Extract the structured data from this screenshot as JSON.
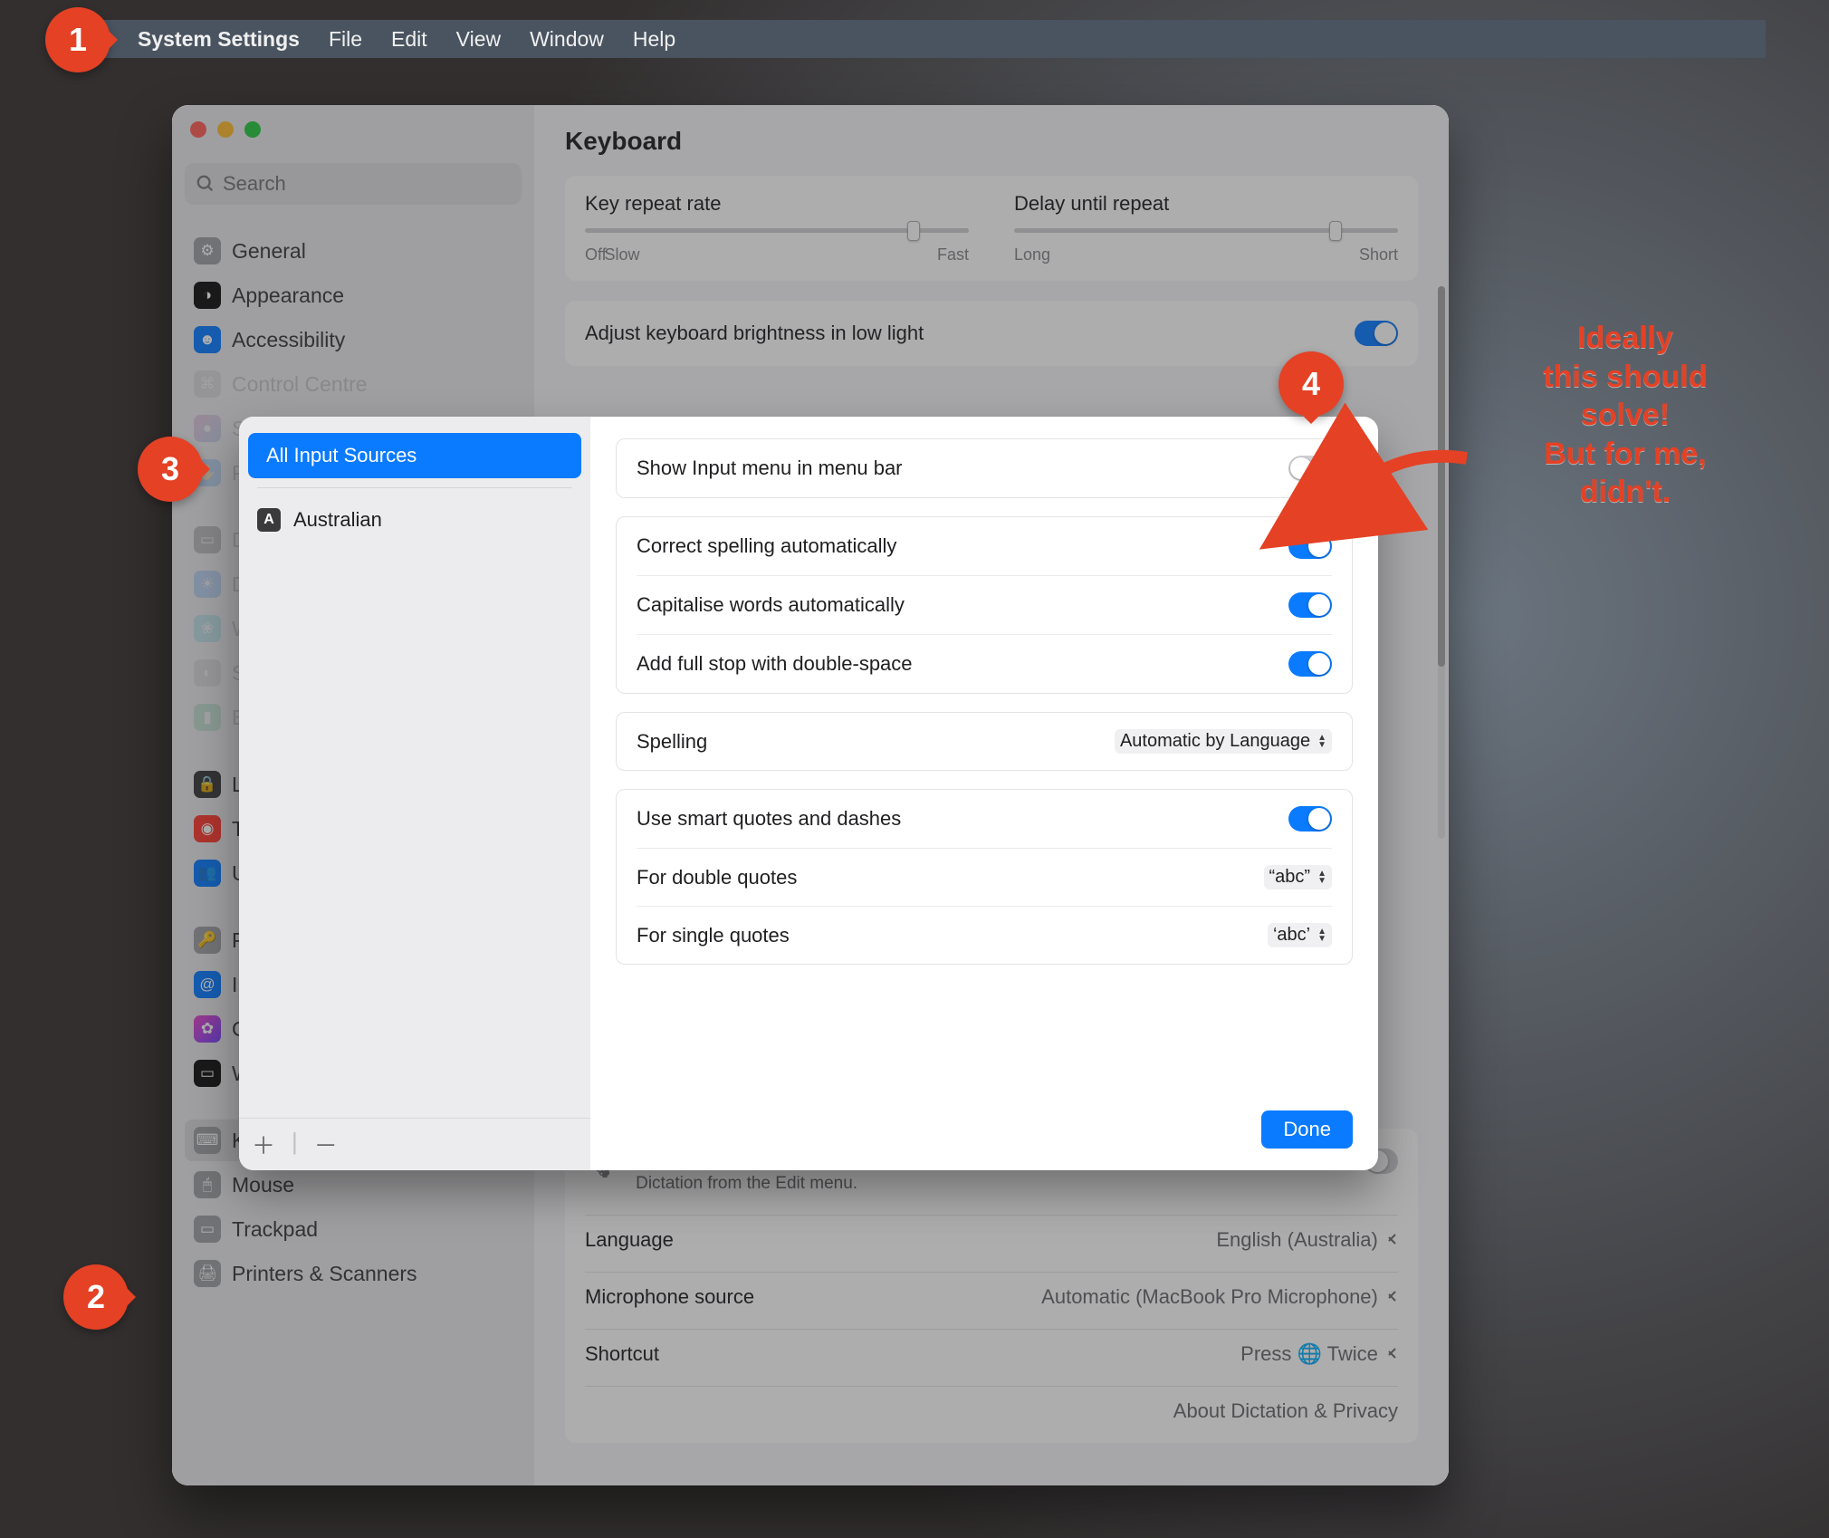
{
  "menubar": {
    "app": "System Settings",
    "items": [
      "File",
      "Edit",
      "View",
      "Window",
      "Help"
    ]
  },
  "search": {
    "placeholder": "Search"
  },
  "sidebar": {
    "items": [
      {
        "label": "General"
      },
      {
        "label": "Appearance"
      },
      {
        "label": "Accessibility"
      },
      {
        "label": "Control Centre"
      },
      {
        "label": "Siri & Spotlight"
      },
      {
        "label": "Privacy & Security"
      },
      {
        "label": "Desktop & Dock"
      },
      {
        "label": "Displays"
      },
      {
        "label": "Wallpaper"
      },
      {
        "label": "Screen Saver"
      },
      {
        "label": "Battery"
      },
      {
        "label": "Lock Screen"
      },
      {
        "label": "Touch ID & Password"
      },
      {
        "label": "Users & Groups"
      },
      {
        "label": "Passwords"
      },
      {
        "label": "Internet Accounts"
      },
      {
        "label": "Game Center"
      },
      {
        "label": "Wallet & Apple Pay"
      },
      {
        "label": "Keyboard"
      },
      {
        "label": "Mouse"
      },
      {
        "label": "Trackpad"
      },
      {
        "label": "Printers & Scanners"
      }
    ],
    "selected": 18
  },
  "page": {
    "title": "Keyboard",
    "key_repeat": {
      "label": "Key repeat rate",
      "left": "Off",
      "left2": "Slow",
      "right": "Fast"
    },
    "delay_repeat": {
      "label": "Delay until repeat",
      "left": "Long",
      "right": "Short"
    },
    "brightness_row": "Adjust keyboard brightness in low light",
    "dictation_hint": "Use Dictation wherever you can type text. To start dictating, use the shortcut or select Start Dictation from the Edit menu.",
    "lang_row": {
      "label": "Language",
      "value": "English (Australia)"
    },
    "mic_row": {
      "label": "Microphone source",
      "value": "Automatic (MacBook Pro Microphone)"
    },
    "shortcut_row": {
      "label": "Shortcut",
      "value": "Press 🌐 Twice"
    },
    "about": "About Dictation & Privacy"
  },
  "sheet": {
    "side": {
      "all": "All Input Sources",
      "items": [
        {
          "glyph": "A",
          "label": "Australian"
        }
      ]
    },
    "rows": {
      "show_menu": "Show Input menu in menu bar",
      "spell_auto": "Correct spelling automatically",
      "cap_auto": "Capitalise words automatically",
      "fullstop": "Add full stop with double-space",
      "spelling": {
        "label": "Spelling",
        "value": "Automatic by Language"
      },
      "smartq": "Use smart quotes and dashes",
      "dblq": {
        "label": "For double quotes",
        "value": "“abc”"
      },
      "sglq": {
        "label": "For single quotes",
        "value": "‘abc’"
      }
    },
    "done": "Done"
  },
  "annotations": {
    "c1": "1",
    "c2": "2",
    "c3": "3",
    "c4": "4",
    "note": "Ideally\nthis should\nsolve!\nBut for me,\ndidn't."
  }
}
